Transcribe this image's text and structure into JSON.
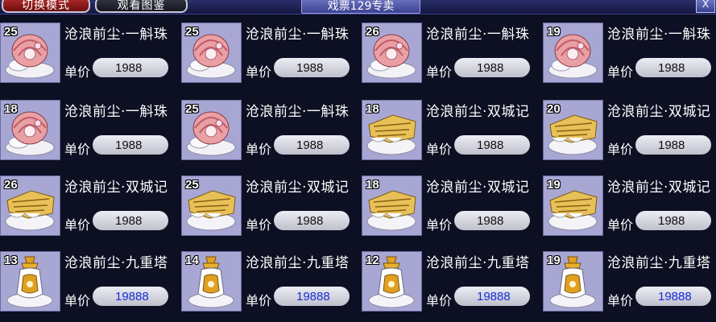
{
  "header": {
    "switch_mode_label": "切换模式",
    "view_catalog_label": "观看图鉴",
    "title": "戏票129专卖",
    "close_label": "X"
  },
  "price_label": "单价",
  "items": [
    {
      "qty": "25",
      "name": "沧浪前尘·一斛珠",
      "price": "1988",
      "icon": "pearl-shell-icon",
      "price_color": "#111111"
    },
    {
      "qty": "25",
      "name": "沧浪前尘·一斛珠",
      "price": "1988",
      "icon": "pearl-shell-icon",
      "price_color": "#111111"
    },
    {
      "qty": "26",
      "name": "沧浪前尘·一斛珠",
      "price": "1988",
      "icon": "pearl-shell-icon",
      "price_color": "#111111"
    },
    {
      "qty": "19",
      "name": "沧浪前尘·一斛珠",
      "price": "1988",
      "icon": "pearl-shell-icon",
      "price_color": "#111111"
    },
    {
      "qty": "18",
      "name": "沧浪前尘·一斛珠",
      "price": "1988",
      "icon": "pearl-shell-icon",
      "price_color": "#111111"
    },
    {
      "qty": "25",
      "name": "沧浪前尘·一斛珠",
      "price": "1988",
      "icon": "pearl-shell-icon",
      "price_color": "#111111"
    },
    {
      "qty": "18",
      "name": "沧浪前尘·双城记",
      "price": "1988",
      "icon": "scroll-cloud-icon",
      "price_color": "#111111"
    },
    {
      "qty": "20",
      "name": "沧浪前尘·双城记",
      "price": "1988",
      "icon": "scroll-cloud-icon",
      "price_color": "#111111"
    },
    {
      "qty": "26",
      "name": "沧浪前尘·双城记",
      "price": "1988",
      "icon": "scroll-cloud-icon",
      "price_color": "#111111"
    },
    {
      "qty": "25",
      "name": "沧浪前尘·双城记",
      "price": "1988",
      "icon": "scroll-cloud-icon",
      "price_color": "#111111"
    },
    {
      "qty": "18",
      "name": "沧浪前尘·双城记",
      "price": "1988",
      "icon": "scroll-cloud-icon",
      "price_color": "#111111"
    },
    {
      "qty": "19",
      "name": "沧浪前尘·双城记",
      "price": "1988",
      "icon": "scroll-cloud-icon",
      "price_color": "#111111"
    },
    {
      "qty": "13",
      "name": "沧浪前尘·九重塔",
      "price": "19888",
      "icon": "pagoda-vase-icon",
      "price_color": "#1430d8"
    },
    {
      "qty": "14",
      "name": "沧浪前尘·九重塔",
      "price": "19888",
      "icon": "pagoda-vase-icon",
      "price_color": "#1430d8"
    },
    {
      "qty": "12",
      "name": "沧浪前尘·九重塔",
      "price": "19888",
      "icon": "pagoda-vase-icon",
      "price_color": "#1430d8"
    },
    {
      "qty": "19",
      "name": "沧浪前尘·九重塔",
      "price": "19888",
      "icon": "pagoda-vase-icon",
      "price_color": "#1430d8"
    }
  ]
}
